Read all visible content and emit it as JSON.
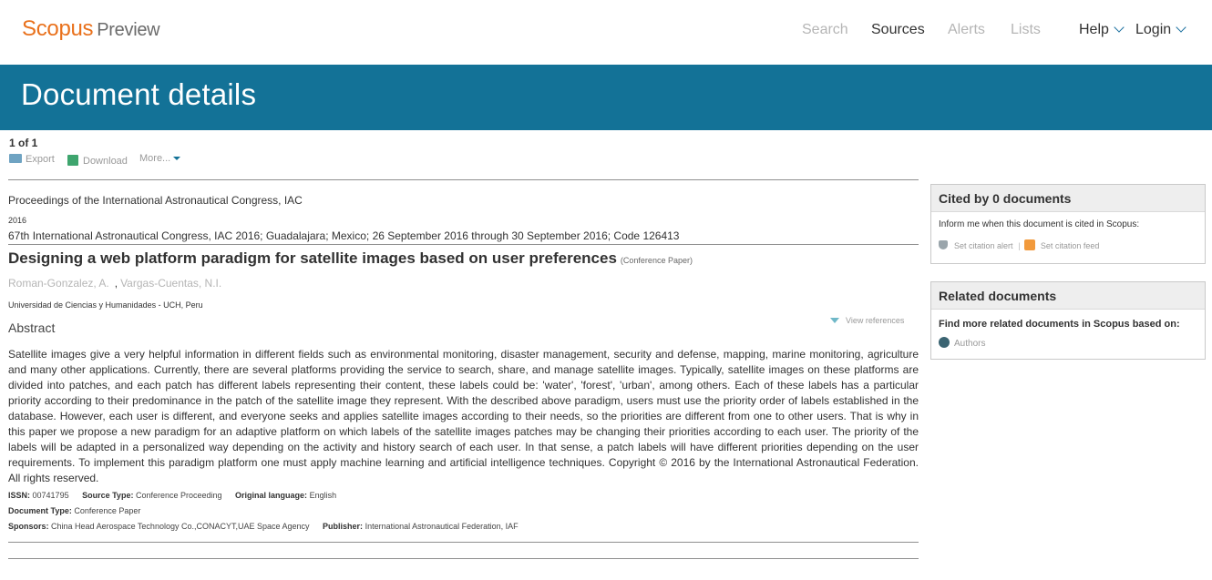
{
  "nav": {
    "brand": "Scopus",
    "brand_sub": "Preview",
    "links": [
      "Search",
      "Sources",
      "Alerts",
      "Lists",
      "Help",
      "Login"
    ]
  },
  "banner": {
    "title": "Document details"
  },
  "results": {
    "count": "1 of 1"
  },
  "toolbar": {
    "export": "Export",
    "download": "Download",
    "more": "More..."
  },
  "document": {
    "source": "Proceedings of the International Astronautical Congress, IAC",
    "year": "2016",
    "conference": "67th International Astronautical Congress, IAC 2016; Guadalajara; Mexico; 26 September 2016 through 30 September 2016; Code 126413",
    "title": "Designing a web platform paradigm for satellite images based on user preferences",
    "doc_type_tag": "(Conference Paper)",
    "authors": [
      "Roman-Gonzalez, A.",
      "Vargas-Cuentas, N.I."
    ],
    "author_separator": ",",
    "affiliation": "Universidad de Ciencias y Humanidades - UCH, Peru",
    "abstract_heading": "Abstract",
    "view_references": "View references",
    "abstract": "Satellite images give a very helpful information in different fields such as environmental monitoring, disaster management, security and defense, mapping, marine monitoring, agriculture and many other applications. Currently, there are several platforms providing the service to search, share, and manage satellite images. Typically, satellite images on these platforms are divided into patches, and each patch has different labels representing their content, these labels could be: 'water', 'forest', 'urban', among others. Each of these labels has a particular priority according to their predominance in the patch of the satellite image they represent. With the described above paradigm, users must use the priority order of labels established in the database. However, each user is different, and everyone seeks and applies satellite images according to their needs, so the priorities are different from one to other users. That is why in this paper we propose a new paradigm for an adaptive platform on which labels of the satellite images patches may be changing their priorities according to each user. The priority of the labels will be adapted in a personalized way depending on the activity and history search of each user. In that sense, a patch labels will have different priorities depending on the user requirements. To implement this paradigm platform one must apply machine learning and artificial intelligence techniques. Copyright © 2016 by the International Astronautical Federation. All rights reserved."
  },
  "metadata": {
    "issn_label": "ISSN:",
    "issn": "00741795",
    "source_type_label": "Source Type:",
    "source_type": "Conference Proceeding",
    "language_label": "Original language:",
    "language": "English",
    "document_type_label": "Document Type:",
    "document_type": "Conference Paper",
    "sponsors_label": "Sponsors:",
    "sponsors": "China Head Aerospace Technology Co.,CONACYT,UAE Space Agency",
    "publisher_label": "Publisher:",
    "publisher": "International Astronautical Federation, IAF"
  },
  "cited_panel": {
    "title": "Cited by 0 documents",
    "text": "Inform me when this document is cited in Scopus:",
    "set_alert": "Set citation alert",
    "separator": "|",
    "set_feed": "Set citation feed"
  },
  "related_panel": {
    "title": "Related documents",
    "text": "Find more related documents in Scopus based on:",
    "authors_link": "Authors"
  },
  "colors": {
    "brand_orange": "#e9711c",
    "banner_blue": "#137297",
    "panel_header_gray": "#eeeeee"
  }
}
